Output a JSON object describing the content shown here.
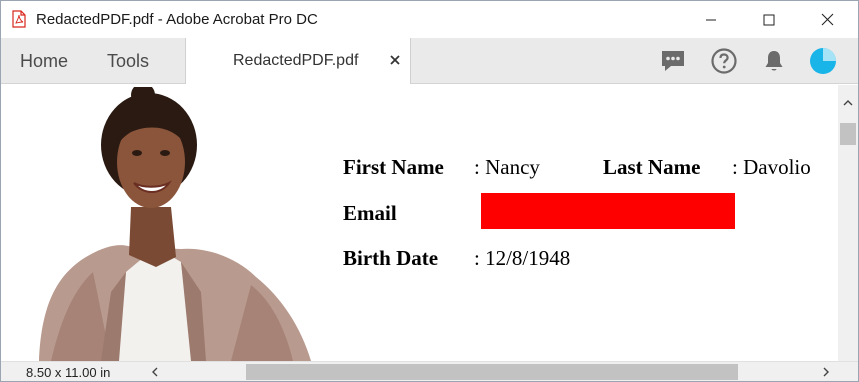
{
  "window": {
    "title": "RedactedPDF.pdf - Adobe Acrobat Pro DC"
  },
  "menubar": {
    "home_label": "Home",
    "tools_label": "Tools",
    "tab_label": "RedactedPDF.pdf",
    "tab_close": "×"
  },
  "document": {
    "first_name_label": "First Name",
    "first_name_value": ": Nancy",
    "last_name_label": "Last Name",
    "last_name_value": ": Davolio",
    "email_label": "Email",
    "redaction_color": "#ff0000",
    "birth_date_label": "Birth Date",
    "birth_date_value": ": 12/8/1948"
  },
  "statusbar": {
    "page_size": "8.50 x 11.00 in"
  },
  "colors": {
    "avatar_accent": "#19b4e8",
    "pdf_icon_red": "#d9261c"
  }
}
